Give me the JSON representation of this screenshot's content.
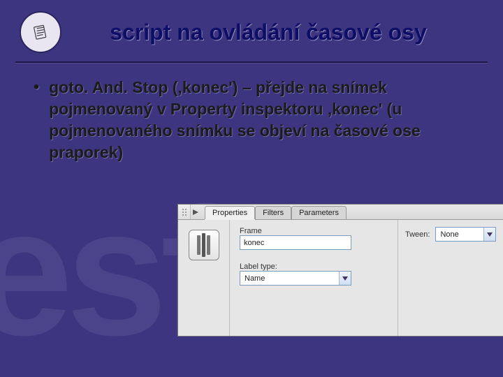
{
  "header": {
    "title": "script na ovládání časové osy"
  },
  "bullet": {
    "text": "goto. And. Stop (‚konec') – přejde na snímek pojmenovaný v Property inspektoru ‚konec' (u pojmenovaného snímku se objeví na časové ose praporek)"
  },
  "panel": {
    "tabs": {
      "properties": "Properties",
      "filters": "Filters",
      "parameters": "Parameters"
    },
    "frame_label": "Frame",
    "frame_value": "konec",
    "labeltype_label": "Label type:",
    "labeltype_value": "Name",
    "tween_label": "Tween:",
    "tween_value": "None"
  }
}
